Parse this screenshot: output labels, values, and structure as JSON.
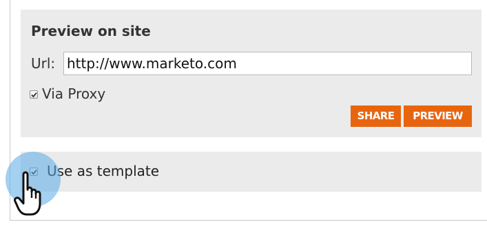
{
  "preview_panel": {
    "title": "Preview on site",
    "url_label": "Url:",
    "url_value": "http://www.marketo.com",
    "via_proxy_label": "Via Proxy",
    "via_proxy_checked": true,
    "share_label": "SHARE",
    "preview_label": "PREVIEW"
  },
  "template_panel": {
    "use_as_template_label": "Use as template",
    "use_as_template_checked": true
  },
  "colors": {
    "button_orange": "#e8650f",
    "panel_gray": "#ebebeb",
    "click_highlight": "#5aaae6"
  },
  "cursor": {
    "icon": "hand-pointer-icon"
  }
}
